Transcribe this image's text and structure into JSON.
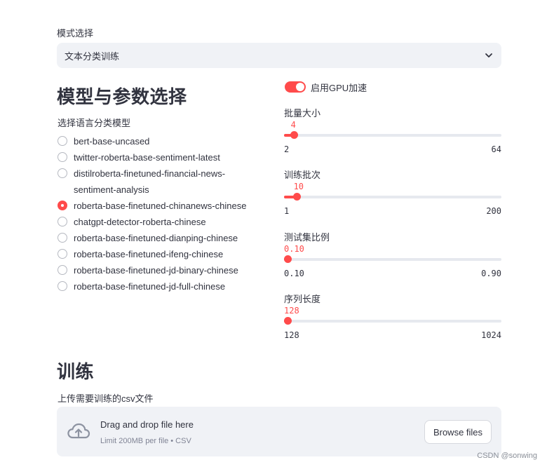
{
  "mode": {
    "label": "模式选择",
    "selected": "文本分类训练"
  },
  "model_section": {
    "title": "模型与参数选择",
    "radio_label": "选择语言分类模型",
    "options": [
      "bert-base-uncased",
      "twitter-roberta-base-sentiment-latest",
      "distilroberta-finetuned-financial-news-sentiment-analysis",
      "roberta-base-finetuned-chinanews-chinese",
      "chatgpt-detector-roberta-chinese",
      "roberta-base-finetuned-dianping-chinese",
      "roberta-base-finetuned-ifeng-chinese",
      "roberta-base-finetuned-jd-binary-chinese",
      "roberta-base-finetuned-jd-full-chinese"
    ],
    "selected_index": 3
  },
  "gpu_toggle": {
    "label": "启用GPU加速",
    "on": true
  },
  "sliders": [
    {
      "label": "批量大小",
      "value": "4",
      "min": "2",
      "max": "64",
      "value_num": 4,
      "min_num": 2,
      "max_num": 64
    },
    {
      "label": "训练批次",
      "value": "10",
      "min": "1",
      "max": "200",
      "value_num": 10,
      "min_num": 1,
      "max_num": 200
    },
    {
      "label": "测试集比例",
      "value": "0.10",
      "min": "0.10",
      "max": "0.90",
      "value_num": 0.1,
      "min_num": 0.1,
      "max_num": 0.9
    },
    {
      "label": "序列长度",
      "value": "128",
      "min": "128",
      "max": "1024",
      "value_num": 128,
      "min_num": 128,
      "max_num": 1024
    }
  ],
  "train_section": {
    "title": "训练",
    "upload_label": "上传需要训练的csv文件",
    "drop_title": "Drag and drop file here",
    "drop_limit": "Limit 200MB per file • CSV",
    "browse_label": "Browse files"
  },
  "watermark": "CSDN @sonwing",
  "colors": {
    "accent": "#ff4b4b",
    "widget_bg": "#f0f2f6",
    "text": "#31333f"
  }
}
